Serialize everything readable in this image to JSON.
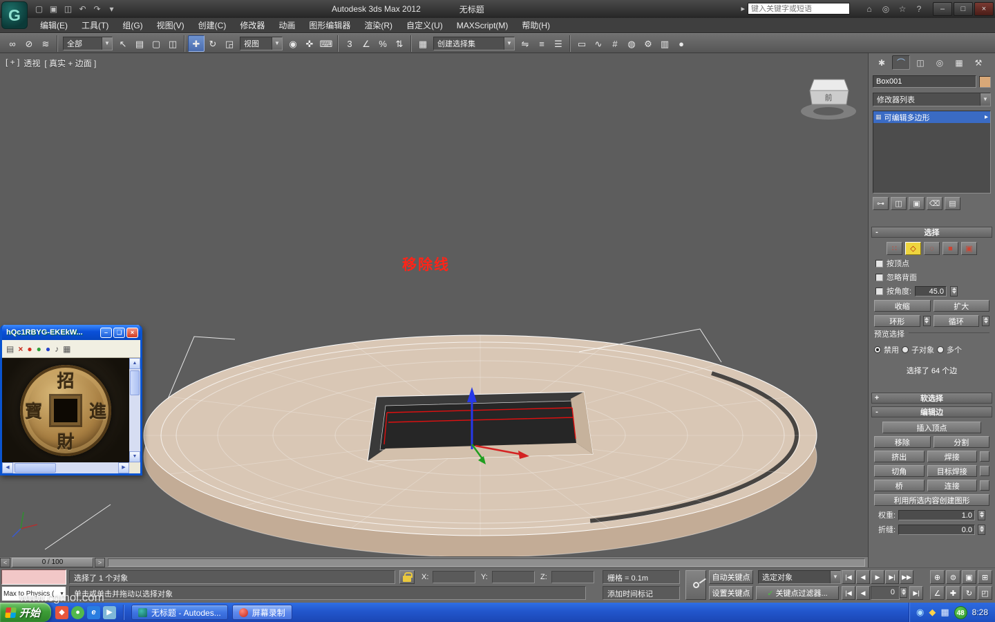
{
  "colors": {
    "selection_blue": "#3a6bc4",
    "subobject_yellow": "#eed53e",
    "annotation_red": "#ff2418",
    "taskbar_blue": "#2256cc",
    "start_green": "#3d9e37",
    "model_tan": "#d9c7b5",
    "viewport_gray": "#5d5d5d"
  },
  "glyphs": {
    "dropdown": "▼"
  },
  "titlebar": {
    "logo_glyph": "G",
    "product": "Autodesk 3ds Max  2012",
    "document": "无标题",
    "search_arrow": "▸",
    "search_placeholder": "键入关键字或短语",
    "left_icons": [
      {
        "name": "new-scene-icon",
        "glyph": "▢"
      },
      {
        "name": "open-file-icon",
        "glyph": "▣"
      },
      {
        "name": "save-file-icon",
        "glyph": "◫"
      },
      {
        "name": "undo-icon",
        "glyph": "↶"
      },
      {
        "name": "redo-icon",
        "glyph": "↷"
      },
      {
        "name": "project-dropdown-icon",
        "glyph": "▾"
      }
    ],
    "right_icons": [
      {
        "name": "search-home-icon",
        "glyph": "⌂"
      },
      {
        "name": "communication-center-icon",
        "glyph": "◎"
      },
      {
        "name": "favorites-icon",
        "glyph": "☆"
      },
      {
        "name": "help-icon",
        "glyph": "?"
      }
    ],
    "window_controls": [
      {
        "name": "minimize-button",
        "glyph": "–"
      },
      {
        "name": "maximize-button",
        "glyph": "□"
      },
      {
        "name": "close-button",
        "glyph": "×",
        "cls": "close"
      }
    ]
  },
  "menubar": {
    "items": [
      {
        "name": "menu-edit",
        "label": "编辑(E)"
      },
      {
        "name": "menu-tools",
        "label": "工具(T)"
      },
      {
        "name": "menu-group",
        "label": "组(G)"
      },
      {
        "name": "menu-views",
        "label": "视图(V)"
      },
      {
        "name": "menu-create",
        "label": "创建(C)"
      },
      {
        "name": "menu-modifiers",
        "label": "修改器"
      },
      {
        "name": "menu-animation",
        "label": "动画"
      },
      {
        "name": "menu-graph-editors",
        "label": "图形编辑器"
      },
      {
        "name": "menu-rendering",
        "label": "渲染(R)"
      },
      {
        "name": "menu-customize",
        "label": "自定义(U)"
      },
      {
        "name": "menu-maxscript",
        "label": "MAXScript(M)"
      },
      {
        "name": "menu-help",
        "label": "帮助(H)"
      }
    ]
  },
  "toolbar": {
    "g1": [
      {
        "name": "select-and-link-icon",
        "glyph": "∞"
      },
      {
        "name": "unlink-selection-icon",
        "glyph": "⊘"
      },
      {
        "name": "bind-to-space-warp-icon",
        "glyph": "≋"
      }
    ],
    "filter_value": "全部",
    "g2": [
      {
        "name": "select-object-icon",
        "glyph": "↖"
      },
      {
        "name": "select-by-name-icon",
        "glyph": "▤"
      },
      {
        "name": "rectangular-selection-icon",
        "glyph": "▢"
      },
      {
        "name": "window-crossing-icon",
        "glyph": "◫"
      }
    ],
    "g3": [
      {
        "name": "select-and-move-icon",
        "glyph": "✚",
        "cls": "active"
      },
      {
        "name": "select-and-rotate-icon",
        "glyph": "↻"
      },
      {
        "name": "select-and-scale-icon",
        "glyph": "◲"
      }
    ],
    "coord_value": "视图",
    "g4": [
      {
        "name": "use-pivot-center-icon",
        "glyph": "◉"
      },
      {
        "name": "select-and-manipulate-icon",
        "glyph": "✜"
      },
      {
        "name": "keyboard-override-icon",
        "glyph": "⌨"
      }
    ],
    "g5": [
      {
        "name": "snap-toggle-3d-icon",
        "glyph": "3"
      },
      {
        "name": "angle-snap-icon",
        "glyph": "∠"
      },
      {
        "name": "percent-snap-icon",
        "glyph": "%"
      },
      {
        "name": "spinner-snap-icon",
        "glyph": "⇅"
      }
    ],
    "g6": [
      {
        "name": "edit-named-selection-sets-icon",
        "glyph": "▦"
      }
    ],
    "selset_value": "创建选择集",
    "g7": [
      {
        "name": "mirror-icon",
        "glyph": "⇋"
      },
      {
        "name": "align-icon",
        "glyph": "≡"
      },
      {
        "name": "layer-manager-icon",
        "glyph": "☰"
      }
    ],
    "g8": [
      {
        "name": "graphite-ribbon-icon",
        "glyph": "▭"
      },
      {
        "name": "curve-editor-icon",
        "glyph": "∿"
      },
      {
        "name": "schematic-view-icon",
        "glyph": "#"
      },
      {
        "name": "material-editor-icon",
        "glyph": "◍"
      },
      {
        "name": "render-setup-icon",
        "glyph": "⚙"
      },
      {
        "name": "rendered-frame-icon",
        "glyph": "▥"
      },
      {
        "name": "render-production-icon",
        "glyph": "●"
      }
    ]
  },
  "viewport": {
    "label_plus": "[ + ]",
    "label_view": "透视",
    "label_shading": "[ 真实 + 边面 ]",
    "annotation": "移除线",
    "viewcube_front": "前"
  },
  "command_panel": {
    "tabs": [
      {
        "name": "tab-create",
        "glyph": "✱"
      },
      {
        "name": "tab-modify",
        "glyph": "⌒",
        "cls": "active"
      },
      {
        "name": "tab-hierarchy",
        "glyph": "◫"
      },
      {
        "name": "tab-motion",
        "glyph": "◎"
      },
      {
        "name": "tab-display",
        "glyph": "▦"
      },
      {
        "name": "tab-utilities",
        "glyph": "⚒"
      }
    ],
    "object_name": "Box001",
    "modifier_list_label": "修改器列表",
    "stack_icon": "▦",
    "stack_item": "可编辑多边形",
    "stack_arrow": "▸",
    "stack_tools": [
      {
        "name": "pin-stack-icon",
        "glyph": "⊶"
      },
      {
        "name": "show-end-result-icon",
        "glyph": "◫"
      },
      {
        "name": "make-unique-icon",
        "glyph": "▣"
      },
      {
        "name": "remove-modifier-icon",
        "glyph": "⌫"
      },
      {
        "name": "configure-modifier-sets-icon",
        "glyph": "▤"
      }
    ],
    "selection": {
      "collapse_glyph": "-",
      "title": "选择",
      "subobject_icons": [
        {
          "name": "vertex-mode-icon",
          "glyph": "∷"
        },
        {
          "name": "edge-mode-icon",
          "glyph": "◇",
          "cls": "active"
        },
        {
          "name": "border-mode-icon",
          "glyph": "◌"
        },
        {
          "name": "polygon-mode-icon",
          "glyph": "■"
        },
        {
          "name": "element-mode-icon",
          "glyph": "▣"
        }
      ],
      "by_vertex": "按顶点",
      "ignore_backfacing": "忽略背面",
      "by_angle": "按角度:",
      "angle_value": "45.0",
      "shrink": "收缩",
      "grow": "扩大",
      "ring": "环形",
      "loop": "循环",
      "preview_label": "预览选择",
      "radio_disable": "禁用",
      "radio_subobj": "子对象",
      "radio_multi": "多个",
      "status": "选择了 64 个边"
    },
    "soft_selection": {
      "collapse_glyph": "+",
      "title": "软选择"
    },
    "edit_edges": {
      "collapse_glyph": "-",
      "title": "编辑边",
      "insert_vertex": "插入顶点",
      "buttons": [
        "移除",
        "分割",
        "挤出",
        "焊接",
        "切角",
        "目标焊接",
        "桥",
        "连接"
      ],
      "create_shape": "利用所选内容创建图形",
      "weight_label": "权重:",
      "weight_value": "1.0",
      "crease_label": "折缝:",
      "crease_value": "0.0"
    }
  },
  "image_window": {
    "title": "hQc1RBYG-EKEkW...",
    "controls": [
      {
        "name": "win-minimize-button",
        "glyph": "–"
      },
      {
        "name": "win-restore-button",
        "glyph": "❏"
      },
      {
        "name": "win-close-button",
        "glyph": "×",
        "cls": "close"
      }
    ],
    "toolbar": [
      {
        "name": "print-icon",
        "glyph": "▤"
      },
      {
        "name": "delete-icon",
        "glyph": "×",
        "cls": "redx"
      },
      {
        "name": "red-dot-button",
        "glyph": "●",
        "cls": "dot-red"
      },
      {
        "name": "green-dot-button",
        "glyph": "●",
        "cls": "dot-green"
      },
      {
        "name": "blue-dot-button",
        "glyph": "●",
        "cls": "dot-blue"
      },
      {
        "name": "volume-icon",
        "glyph": "♪"
      },
      {
        "name": "grid-icon",
        "glyph": "▦"
      }
    ],
    "coin": {
      "top": "招",
      "right": "進",
      "bottom": "財",
      "left": "寶"
    },
    "scroll": {
      "up": "▲",
      "down": "▼",
      "left": "◀",
      "right": "▶"
    }
  },
  "trackbar": {
    "prev": "<",
    "label": "0 / 100",
    "next": ">"
  },
  "statusbar": {
    "listener_text": "Max to Physics (",
    "status_line": "选择了 1 个对象",
    "prompt_line": "单击或单击并拖动以选择对象",
    "x_label": "X:",
    "y_label": "Y:",
    "z_label": "Z:",
    "x_value": "",
    "y_value": "",
    "z_value": "",
    "grid_text": "栅格 = 0.1m",
    "time_tag_text": "添加时间标记",
    "auto_key": "自动关键点",
    "set_key": "设置关键点",
    "selection_filter_value": "选定对象",
    "key_filters_check": "✓",
    "key_filters": "关键点过滤器...",
    "time_controls": [
      {
        "name": "go-to-start-button",
        "glyph": "|◀"
      },
      {
        "name": "previous-frame-button",
        "glyph": "◀"
      },
      {
        "name": "play-animation-button",
        "glyph": "▶"
      },
      {
        "name": "next-frame-button",
        "glyph": "▶|"
      },
      {
        "name": "go-to-end-button",
        "glyph": "▶▶"
      }
    ],
    "frame_prev": "|◀",
    "frame_back": "◀",
    "frame_value": "0",
    "frame_fwd": "▶|",
    "nav_row1": [
      {
        "name": "zoom-icon",
        "glyph": "⊕"
      },
      {
        "name": "zoom-all-icon",
        "glyph": "⊜"
      },
      {
        "name": "zoom-extents-icon",
        "glyph": "▣"
      },
      {
        "name": "zoom-extents-all-icon",
        "glyph": "⊞"
      }
    ],
    "nav_row2": [
      {
        "name": "field-of-view-icon",
        "glyph": "∠"
      },
      {
        "name": "pan-view-icon",
        "glyph": "✚"
      },
      {
        "name": "orbit-view-icon",
        "glyph": "↻"
      },
      {
        "name": "maximize-viewport-icon",
        "glyph": "◰"
      }
    ]
  },
  "taskbar": {
    "start_label": "开始",
    "quick_launch": [
      {
        "name": "quick-launch-icon-1",
        "glyph": "◆",
        "cls": "ql1"
      },
      {
        "name": "quick-launch-icon-2",
        "glyph": "●",
        "cls": "ql2"
      },
      {
        "name": "quick-launch-icon-3",
        "glyph": "e",
        "cls": "ql3"
      },
      {
        "name": "quick-launch-icon-4",
        "glyph": "▶",
        "cls": "ql4"
      }
    ],
    "tasks": [
      {
        "name": "task-3dsmax-button",
        "label": "无标题 - Autodes...",
        "cls": "task-max"
      },
      {
        "name": "task-screen-recorder-button",
        "label": "屏幕录制",
        "cls": "task-rec"
      }
    ],
    "tray_icons": [
      {
        "name": "tray-icon-messenger",
        "glyph": "◉",
        "cls": "tr1"
      },
      {
        "name": "tray-icon-security",
        "glyph": "◆",
        "cls": "tr2"
      },
      {
        "name": "tray-icon-input-method",
        "glyph": "▦",
        "cls": "tr3"
      }
    ],
    "tray_badge": "48",
    "clock": "8:28"
  },
  "watermark": "www.cgmol.com"
}
